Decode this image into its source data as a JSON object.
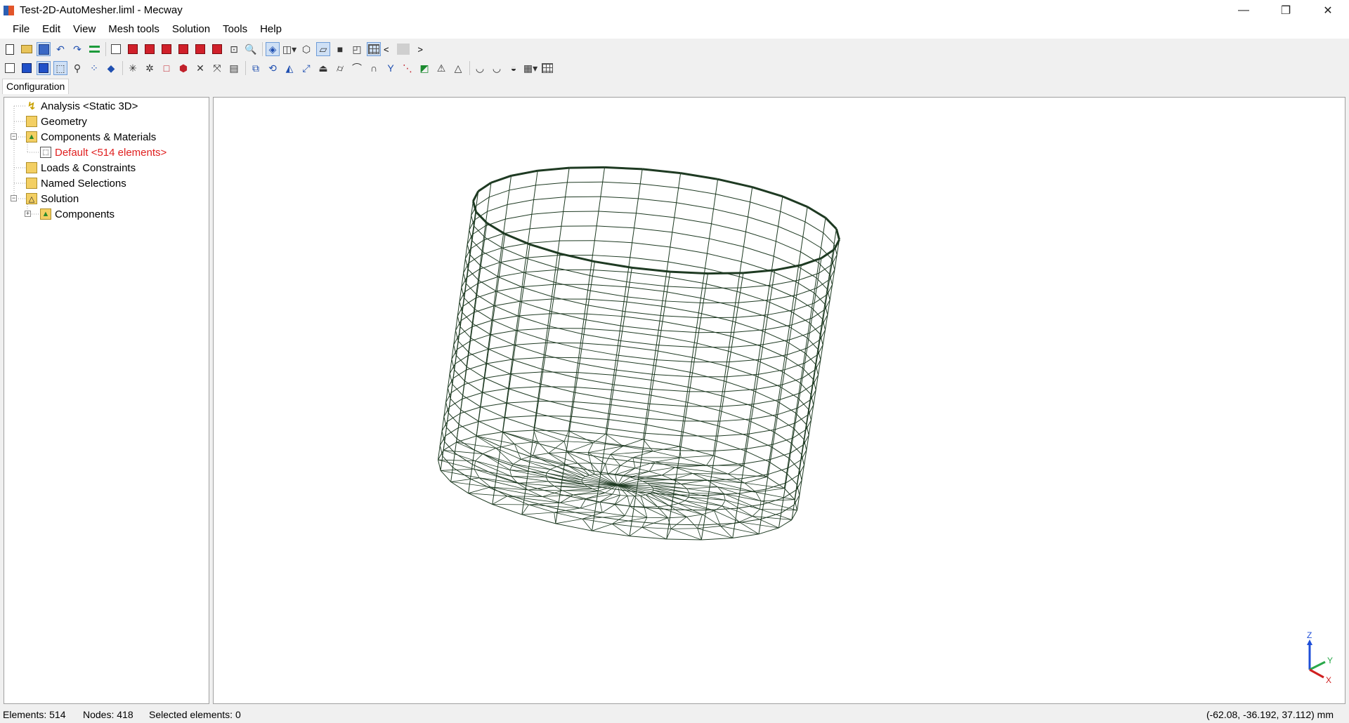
{
  "window": {
    "title": "Test-2D-AutoMesher.liml - Mecway",
    "minimize": "—",
    "restore": "❐",
    "close": "✕"
  },
  "menu": [
    {
      "label": "File"
    },
    {
      "label": "Edit"
    },
    {
      "label": "View"
    },
    {
      "label": "Mesh tools"
    },
    {
      "label": "Solution"
    },
    {
      "label": "Tools"
    },
    {
      "label": "Help"
    }
  ],
  "toolbar": {
    "scroll_left": "<",
    "scroll_right": ">"
  },
  "panel": {
    "tab_label": "Configuration"
  },
  "tree": {
    "analysis": "Analysis <Static 3D>",
    "geometry": "Geometry",
    "components_materials": "Components & Materials",
    "default_component": "Default <514 elements>",
    "loads_constraints": "Loads & Constraints",
    "named_selections": "Named Selections",
    "solution": "Solution",
    "solution_components": "Components"
  },
  "axes": {
    "z": "Z",
    "y": "Y",
    "x": "X"
  },
  "status": {
    "elements": "Elements: 514",
    "nodes": "Nodes: 418",
    "selected": "Selected elements: 0",
    "coordinates": "(-62.08, -36.192, 37.112) mm"
  },
  "colors": {
    "mesh_line": "#1e3a22",
    "selected_text": "#e02020"
  }
}
